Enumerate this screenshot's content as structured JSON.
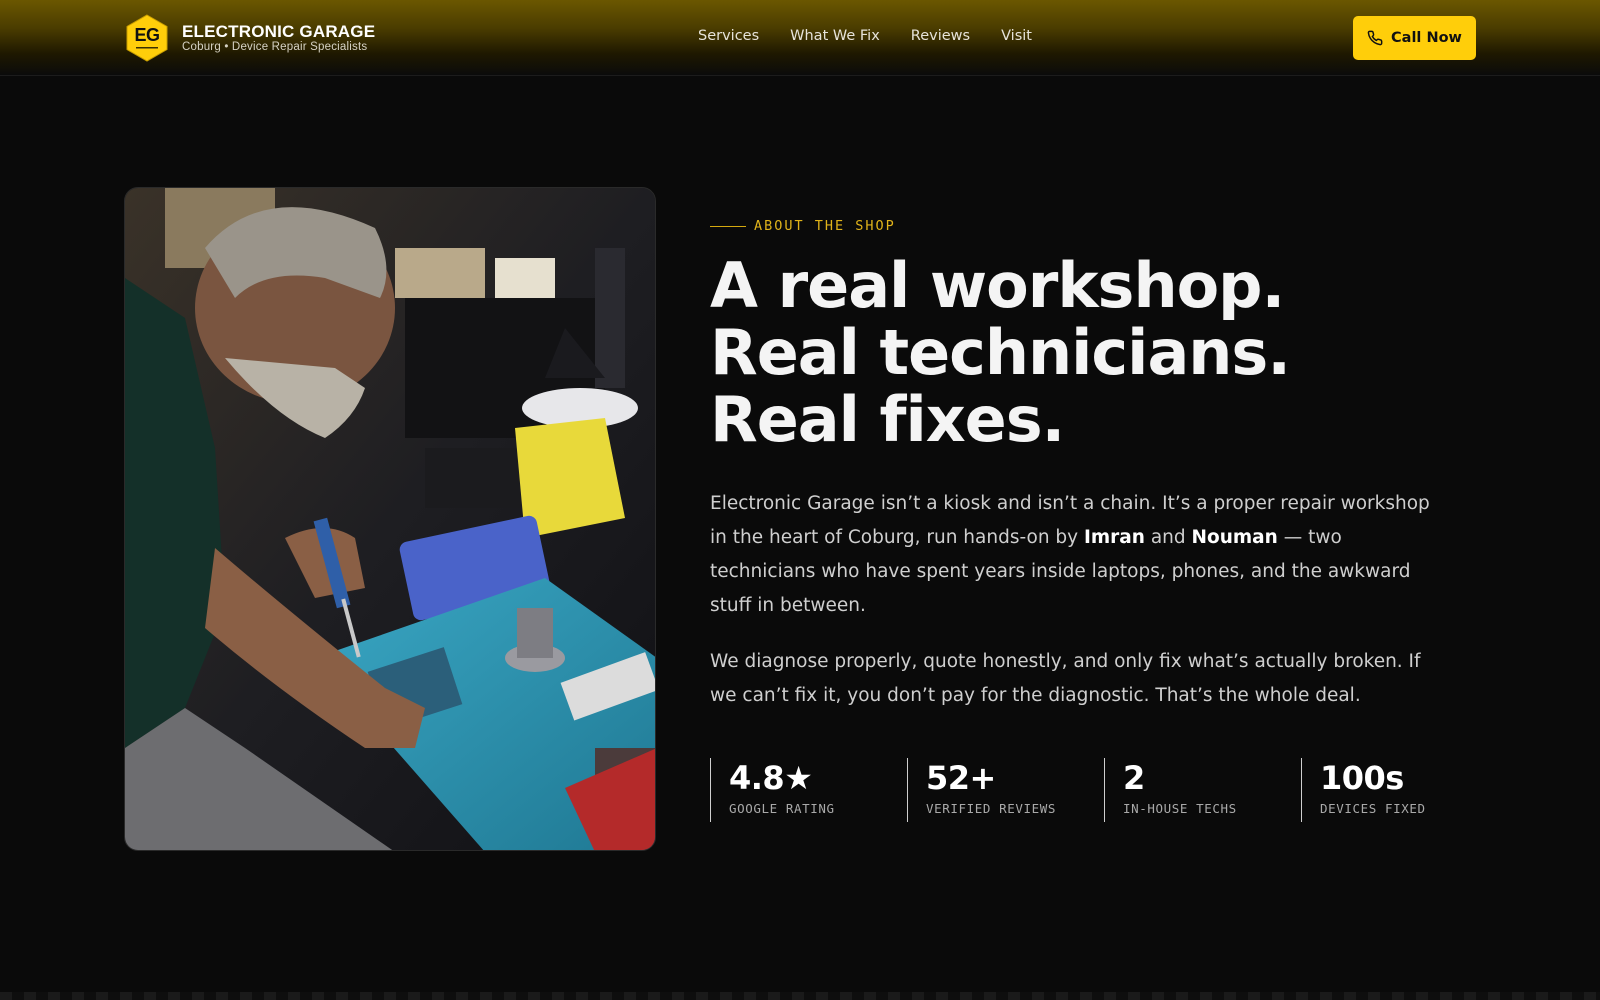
{
  "brand": {
    "logo_text": "EG",
    "name": "ELECTRONIC GARAGE",
    "tagline": "Coburg • Device Repair Specialists",
    "accent_color": "#ffce0a"
  },
  "nav": {
    "items": [
      {
        "label": "Services"
      },
      {
        "label": "What We Fix"
      },
      {
        "label": "Reviews"
      },
      {
        "label": "Visit"
      }
    ]
  },
  "cta": {
    "label": "Call Now",
    "icon": "phone-icon"
  },
  "photo": {
    "description_icon": "photo-technician-soldering"
  },
  "about": {
    "eyebrow": "ABOUT THE SHOP",
    "headline": [
      "A real workshop.",
      "Real technicians.",
      "Real fixes."
    ],
    "para1": {
      "part1": "Electronic Garage isn’t a kiosk and isn’t a chain. It’s a proper repair workshop in the heart of Coburg, run hands-on by ",
      "name1": "Imran",
      "part2": " and ",
      "name2": "Nouman",
      "part3": " — two technicians who have spent years inside laptops, phones, and the awkward stuff in between."
    },
    "para2": "We diagnose properly, quote honestly, and only fix what’s actually broken. If we can’t fix it, you don’t pay for the diagnostic. That’s the whole deal."
  },
  "stats": [
    {
      "value": "4.8★",
      "label": "GOOGLE RATING"
    },
    {
      "value": "52+",
      "label": "VERIFIED REVIEWS"
    },
    {
      "value": "2",
      "label": "IN-HOUSE TECHS"
    },
    {
      "value": "100s",
      "label": "DEVICES FIXED"
    }
  ]
}
